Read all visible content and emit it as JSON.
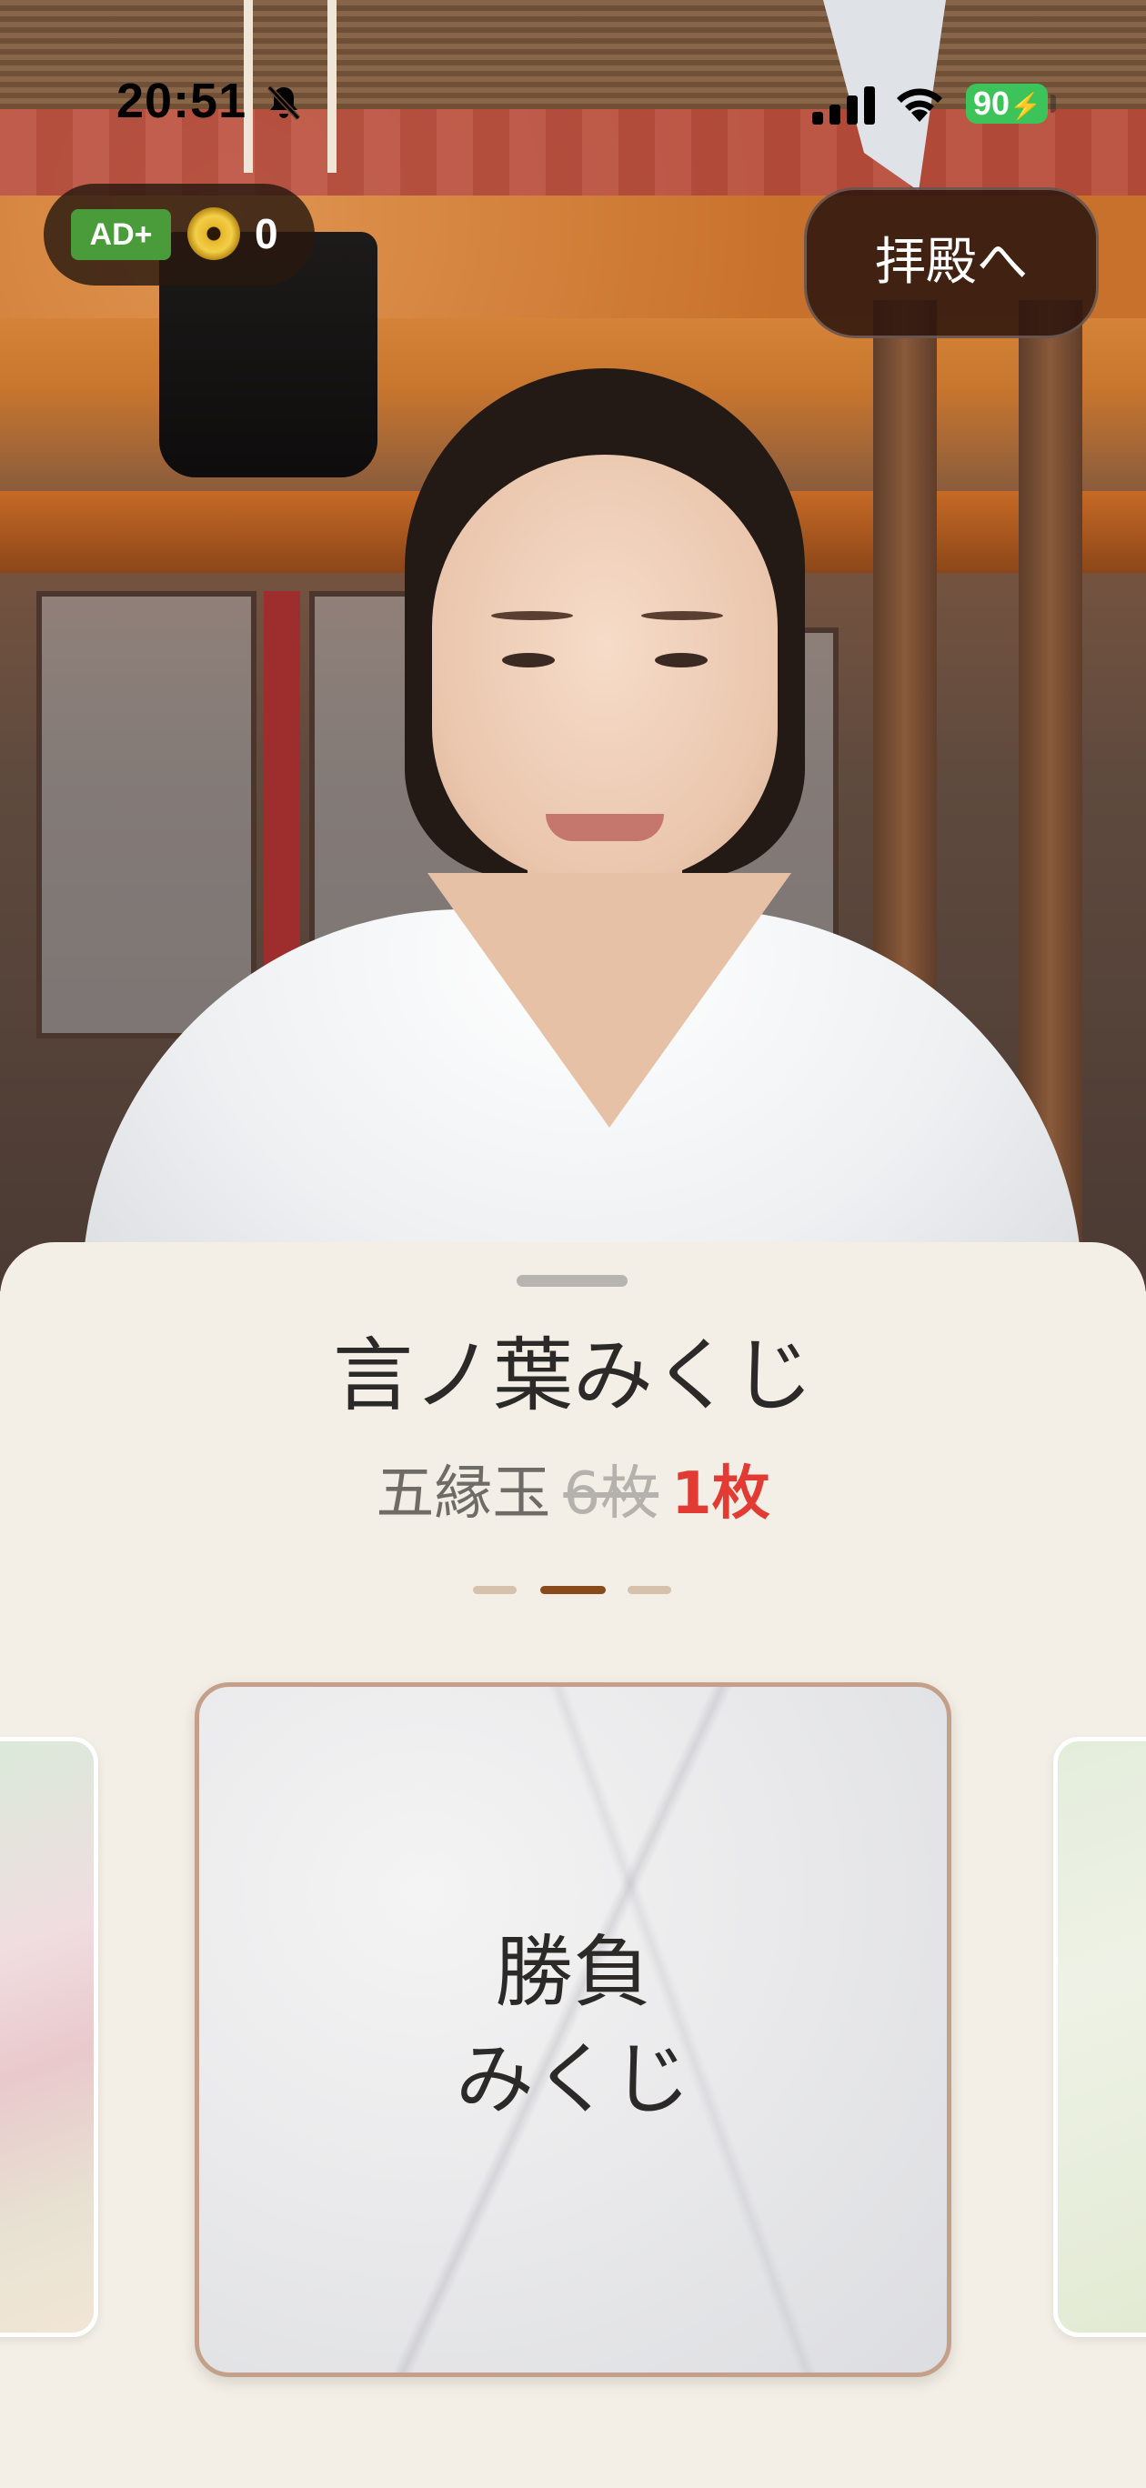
{
  "status_bar": {
    "time": "20:51",
    "battery": "90",
    "icons": [
      "bell-slash-icon",
      "cellular-signal-icon",
      "wifi-icon",
      "battery-charging-icon"
    ]
  },
  "currency": {
    "ad_badge": "AD+",
    "coin_count": "0",
    "coin_icon": "five-yen-coin-icon"
  },
  "header": {
    "hall_button": "拝殿へ"
  },
  "sheet": {
    "title": "言ノ葉みくじ",
    "price": {
      "label": "五縁玉",
      "old": "6枚",
      "new": "1枚"
    },
    "pager": {
      "count": 3,
      "active_index": 1
    },
    "cards": {
      "main_line1": "勝負",
      "main_line2": "みくじ"
    }
  },
  "colors": {
    "sheet_bg": "#f3efe6",
    "price_new": "#e23b34",
    "pager_active": "#8a4b1c",
    "pager_inactive": "#d6c1ad",
    "card_border": "#c4a08a",
    "ad_badge": "#4a9b3a",
    "battery": "#3cc35a"
  }
}
